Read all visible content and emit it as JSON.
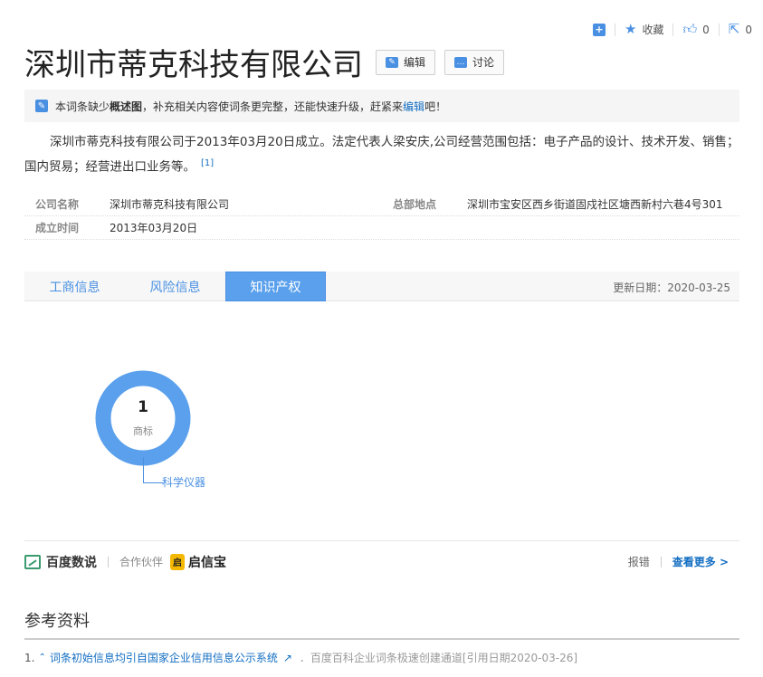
{
  "toolbar": {
    "add_icon": "plus-box-icon",
    "collect_label": "收藏",
    "like_count": "0",
    "share_count": "0"
  },
  "title": "深圳市蒂克科技有限公司",
  "buttons": {
    "edit": "编辑",
    "discuss": "讨论"
  },
  "notice": {
    "prefix": "本词条缺少",
    "bold": "概述图",
    "middle": "，补充相关内容使词条更完整，还能快速升级，赶紧来",
    "link": "编辑",
    "suffix": "吧！"
  },
  "summary": {
    "text": "深圳市蒂克科技有限公司于2013年03月20日成立。法定代表人梁安庆,公司经营范围包括：电子产品的设计、技术开发、销售；国内贸易；经营进出口业务等。",
    "ref": "[1]"
  },
  "info": {
    "company_name_key": "公司名称",
    "company_name_val": "深圳市蒂克科技有限公司",
    "hq_key": "总部地点",
    "hq_val": "深圳市宝安区西乡街道固戍社区塘西新村六巷4号301",
    "founded_key": "成立时间",
    "founded_val": "2013年03月20日"
  },
  "tabs": [
    {
      "label": "工商信息"
    },
    {
      "label": "风险信息"
    },
    {
      "label": "知识产权"
    }
  ],
  "update_date": "更新日期：2020-03-25",
  "donut": {
    "count": "1",
    "label": "商标",
    "segment_label": "科学仪器",
    "color": "#5aa0ec"
  },
  "partners": {
    "logo1": "百度数说",
    "partner_label": "合作伙伴",
    "logo2": "启信宝",
    "report": "报错",
    "more": "查看更多 >"
  },
  "references": {
    "title": "参考资料",
    "items": [
      {
        "num": "1.",
        "text": "词条初始信息均引自国家企业信用信息公示系统",
        "meta": "．百度百科企业词条极速创建通道[引用日期2020-03-26]"
      }
    ]
  }
}
